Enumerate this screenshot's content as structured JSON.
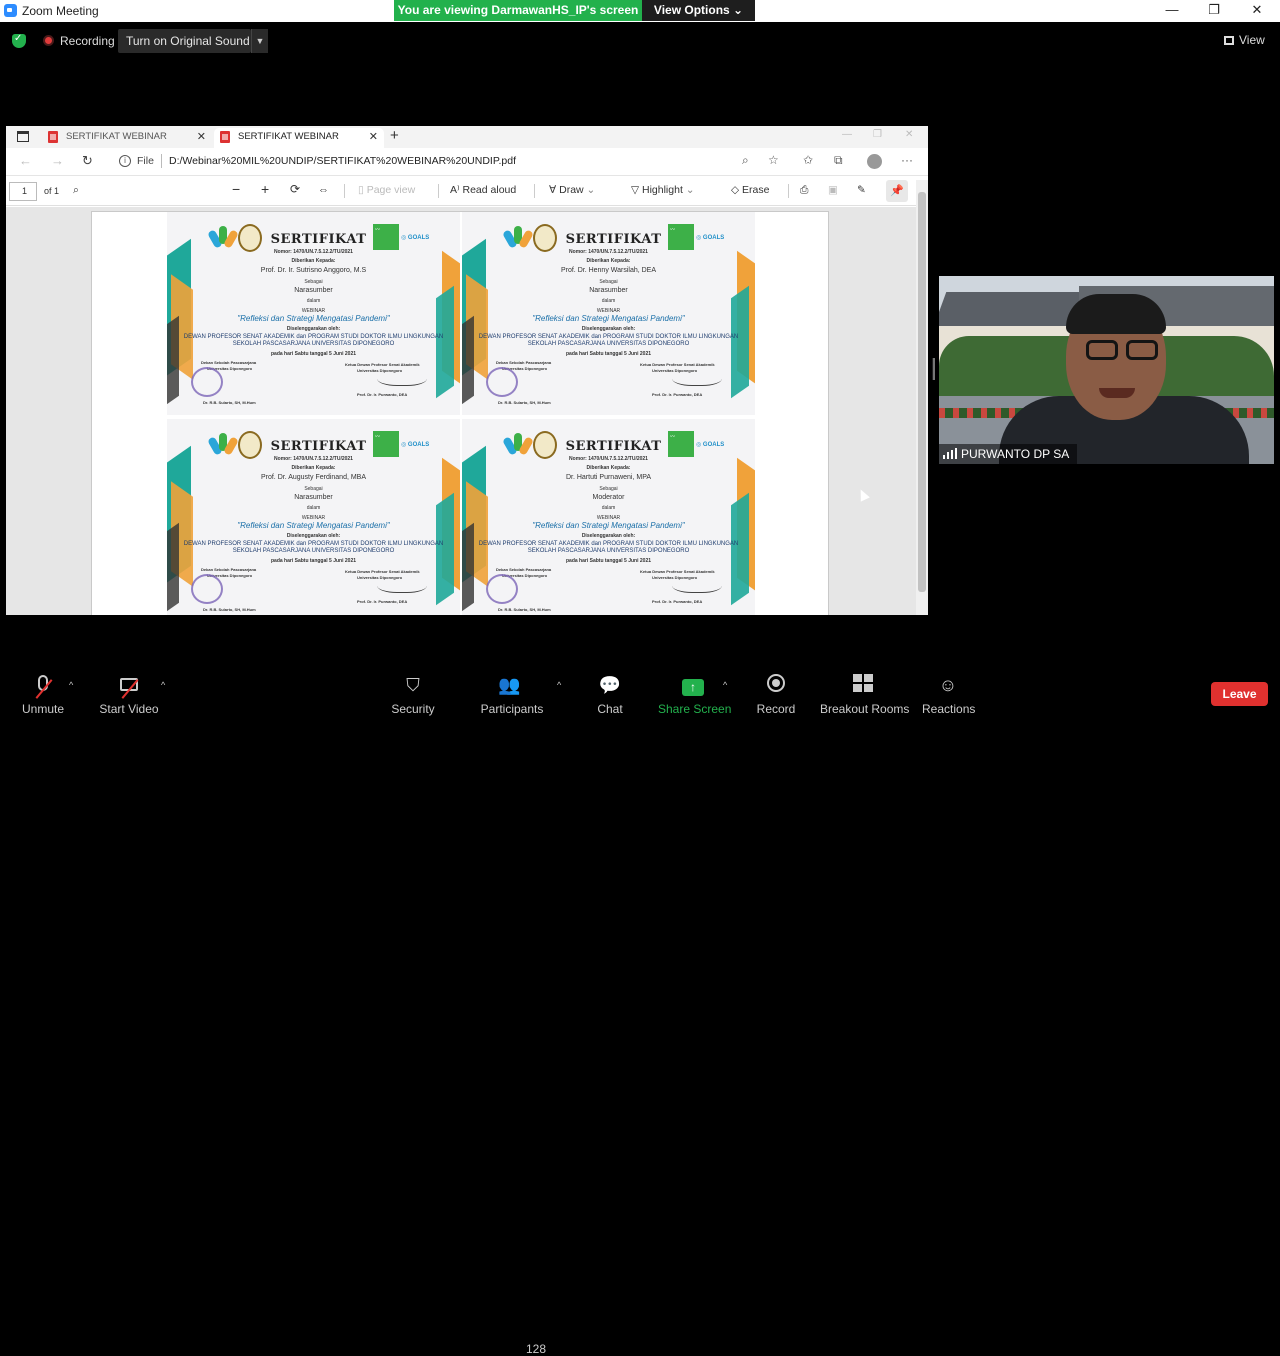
{
  "window": {
    "title": "Zoom Meeting",
    "minimize": "—",
    "restore": "❐",
    "close": "✕"
  },
  "banner": {
    "viewing": "You are viewing DarmawanHS_IP's screen",
    "view_options": "View Options ⌄"
  },
  "meeting_bar": {
    "recording": "Recording",
    "original_sound": "Turn on Original Sound",
    "view": "View"
  },
  "browser": {
    "tabs": [
      {
        "label": "SERTIFIKAT WEBINAR UNDIP.pdf",
        "active": false
      },
      {
        "label": "SERTIFIKAT WEBINAR UNDIP.pdf",
        "active": true
      }
    ],
    "address_prefix": "File",
    "url": "D:/Webinar%20MIL%20UNDIP/SERTIFIKAT%20WEBINAR%20UNDIP.pdf",
    "pdf_toolbar": {
      "page_number": "1",
      "page_total": "of 1",
      "page_view": "Page view",
      "read_aloud": "Read aloud",
      "draw": "Draw",
      "highlight": "Highlight",
      "erase": "Erase"
    }
  },
  "certificates": [
    {
      "title": "SERTIFIKAT",
      "number": "Nomor: 1470/UN.7.5.12.2/TU/2021",
      "given_to": "Diberikan Kepada:",
      "name": "Prof. Dr. Ir. Sutrisno Anggoro, M.S",
      "as": "Sebagai",
      "role": "Narasumber",
      "in": "dalam",
      "event": "WEBINAR",
      "theme": "\"Refleksi dan Strategi Mengatasi Pandemi\"",
      "organized_by": "Diselenggarakan oleh:",
      "org_line1": "DEWAN PROFESOR SENAT AKADEMIK dan PROGRAM STUDI DOKTOR ILMU LINGKUNGAN",
      "org_line2": "SEKOLAH PASCASARJANA UNIVERSITAS DIPONEGORO",
      "date": "pada hari Sabtu tanggal 5 Juni 2021",
      "left_sign_title": "Dekan Sekolah Pascasarjana",
      "left_sign_org": "Universitas Diponegoro",
      "left_sign_name": "Dr. R.B. Sularto, SH, M.Hum",
      "right_sign_title": "Ketua Dewan Profesor Senat Akademik",
      "right_sign_org": "Universitas Diponegoro",
      "right_sign_name": "Prof. Dr. Ir. Purwanto, DEA"
    },
    {
      "title": "SERTIFIKAT",
      "number": "Nomor: 1470/UN.7.5.12.2/TU/2021",
      "given_to": "Diberikan Kepada:",
      "name": "Prof. Dr. Henny Warsilah, DEA",
      "as": "Sebagai",
      "role": "Narasumber",
      "in": "dalam",
      "event": "WEBINAR",
      "theme": "\"Refleksi dan Strategi Mengatasi Pandemi\"",
      "organized_by": "Diselenggarakan oleh:",
      "org_line1": "DEWAN PROFESOR SENAT AKADEMIK dan PROGRAM STUDI DOKTOR ILMU LINGKUNGAN",
      "org_line2": "SEKOLAH PASCASARJANA UNIVERSITAS DIPONEGORO",
      "date": "pada hari Sabtu tanggal 5 Juni 2021",
      "left_sign_title": "Dekan Sekolah Pascasarjana",
      "left_sign_org": "Universitas Diponegoro",
      "left_sign_name": "Dr. R.B. Sularto, SH, M.Hum",
      "right_sign_title": "Ketua Dewan Profesor Senat Akademik",
      "right_sign_org": "Universitas Diponegoro",
      "right_sign_name": "Prof. Dr. Ir. Purwanto, DEA"
    },
    {
      "title": "SERTIFIKAT",
      "number": "Nomor: 1470/UN.7.5.12.2/TU/2021",
      "given_to": "Diberikan Kepada:",
      "name": "Prof. Dr. Augusty Ferdinand, MBA",
      "as": "Sebagai",
      "role": "Narasumber",
      "in": "dalam",
      "event": "WEBINAR",
      "theme": "\"Refleksi dan Strategi Mengatasi Pandemi\"",
      "organized_by": "Diselenggarakan oleh:",
      "org_line1": "DEWAN PROFESOR SENAT AKADEMIK dan PROGRAM STUDI DOKTOR ILMU LINGKUNGAN",
      "org_line2": "SEKOLAH PASCASARJANA UNIVERSITAS DIPONEGORO",
      "date": "pada hari Sabtu tanggal 5 Juni 2021",
      "left_sign_title": "Dekan Sekolah Pascasarjana",
      "left_sign_org": "Universitas Diponegoro",
      "left_sign_name": "Dr. R.B. Sularto, SH, M.Hum",
      "right_sign_title": "Ketua Dewan Profesor Senat Akademik",
      "right_sign_org": "Universitas Diponegoro",
      "right_sign_name": "Prof. Dr. Ir. Purwanto, DEA"
    },
    {
      "title": "SERTIFIKAT",
      "number": "Nomor: 1470/UN.7.5.12.2/TU/2021",
      "given_to": "Diberikan Kepada:",
      "name": "Dr. Hartuti Purnaweni, MPA",
      "as": "Sebagai",
      "role": "Moderator",
      "in": "dalam",
      "event": "WEBINAR",
      "theme": "\"Refleksi dan Strategi Mengatasi Pandemi\"",
      "organized_by": "Diselenggarakan oleh:",
      "org_line1": "DEWAN PROFESOR SENAT AKADEMIK dan PROGRAM STUDI DOKTOR ILMU LINGKUNGAN",
      "org_line2": "SEKOLAH PASCASARJANA UNIVERSITAS DIPONEGORO",
      "date": "pada hari Sabtu tanggal 5 Juni 2021",
      "left_sign_title": "Dekan Sekolah Pascasarjana",
      "left_sign_org": "Universitas Diponegoro",
      "left_sign_name": "Dr. R.B. Sularto, SH, M.Hum",
      "right_sign_title": "Ketua Dewan Profesor Senat Akademik",
      "right_sign_org": "Universitas Diponegoro",
      "right_sign_name": "Prof. Dr. Ir. Purwanto, DEA"
    }
  ],
  "video": {
    "participant_name": "PURWANTO DP SA"
  },
  "toolbar": {
    "unmute": "Unmute",
    "start_video": "Start Video",
    "security": "Security",
    "participants": "Participants",
    "participants_count": "128",
    "chat": "Chat",
    "share_screen": "Share Screen",
    "record": "Record",
    "breakout_rooms": "Breakout Rooms",
    "reactions": "Reactions",
    "leave": "Leave"
  },
  "colors": {
    "banner_green": "#22b14c",
    "leave_red": "#e0312f",
    "share_green": "#23b14d",
    "cert_teal": "#1fa89a",
    "cert_orange": "#f0a23a"
  }
}
